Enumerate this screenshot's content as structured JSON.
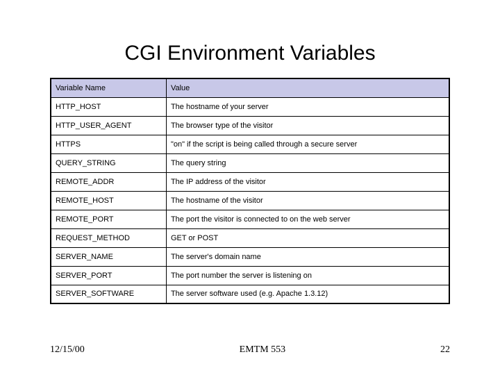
{
  "title": "CGI Environment Variables",
  "table": {
    "headers": {
      "col1": "Variable Name",
      "col2": "Value"
    },
    "rows": [
      {
        "name": "HTTP_HOST",
        "value": "The hostname of your server"
      },
      {
        "name": "HTTP_USER_AGENT",
        "value": "The browser type of the visitor"
      },
      {
        "name": "HTTPS",
        "value": "\"on\" if the script is being called through a secure server"
      },
      {
        "name": "QUERY_STRING",
        "value": "The query string"
      },
      {
        "name": "REMOTE_ADDR",
        "value": "The IP address of the visitor"
      },
      {
        "name": "REMOTE_HOST",
        "value": "The hostname of the visitor"
      },
      {
        "name": "REMOTE_PORT",
        "value": "The port the visitor is connected to on the web server"
      },
      {
        "name": "REQUEST_METHOD",
        "value": "GET or POST"
      },
      {
        "name": "SERVER_NAME",
        "value": "The server's domain name"
      },
      {
        "name": "SERVER_PORT",
        "value": "The port number the server is listening on"
      },
      {
        "name": "SERVER_SOFTWARE",
        "value": "The server software used (e.g. Apache 1.3.12)"
      }
    ]
  },
  "footer": {
    "date": "12/15/00",
    "center": "EMTM 553",
    "page": "22"
  }
}
